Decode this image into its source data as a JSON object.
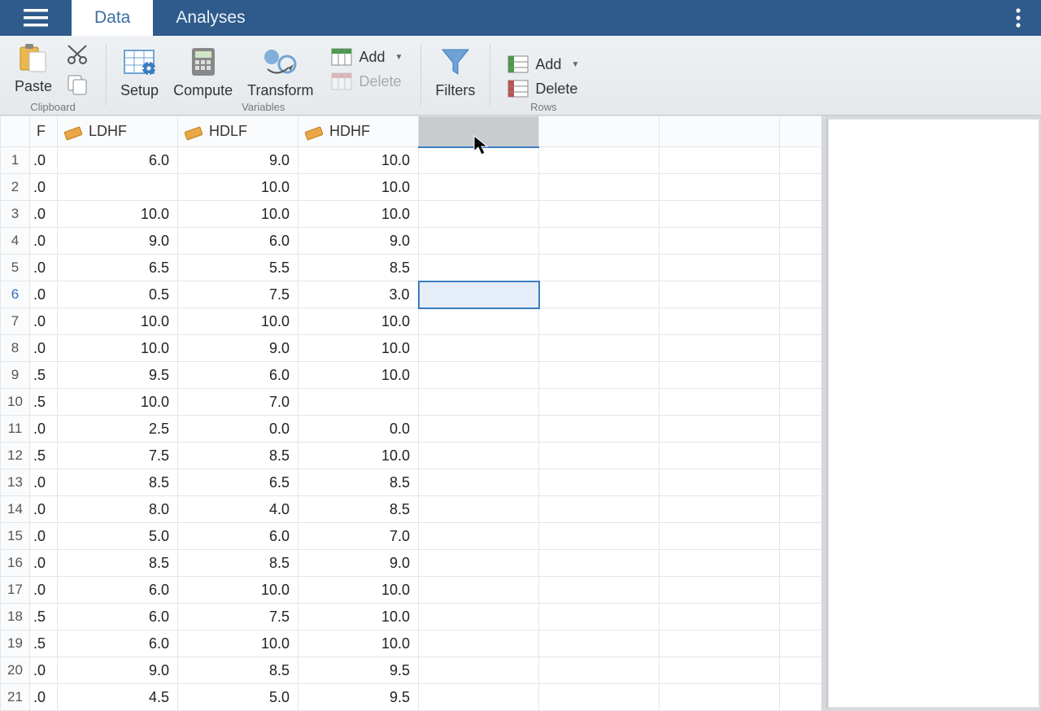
{
  "tabs": {
    "data": "Data",
    "analyses": "Analyses"
  },
  "ribbon": {
    "paste": "Paste",
    "setup": "Setup",
    "compute": "Compute",
    "transform": "Transform",
    "vars_add": "Add",
    "vars_delete": "Delete",
    "filters": "Filters",
    "rows_add": "Add",
    "rows_delete": "Delete",
    "group_clipboard": "Clipboard",
    "group_variables": "Variables",
    "group_rows": "Rows"
  },
  "columns": {
    "c0frag": "F",
    "c1": "LDHF",
    "c2": "HDLF",
    "c3": "HDHF"
  },
  "rows": [
    {
      "frag": ".0",
      "c1": "6.0",
      "c2": "9.0",
      "c3": "10.0"
    },
    {
      "frag": ".0",
      "c1": "",
      "c2": "10.0",
      "c3": "10.0"
    },
    {
      "frag": ".0",
      "c1": "10.0",
      "c2": "10.0",
      "c3": "10.0"
    },
    {
      "frag": ".0",
      "c1": "9.0",
      "c2": "6.0",
      "c3": "9.0"
    },
    {
      "frag": ".0",
      "c1": "6.5",
      "c2": "5.5",
      "c3": "8.5"
    },
    {
      "frag": ".0",
      "c1": "0.5",
      "c2": "7.5",
      "c3": "3.0"
    },
    {
      "frag": ".0",
      "c1": "10.0",
      "c2": "10.0",
      "c3": "10.0"
    },
    {
      "frag": ".0",
      "c1": "10.0",
      "c2": "9.0",
      "c3": "10.0"
    },
    {
      "frag": ".5",
      "c1": "9.5",
      "c2": "6.0",
      "c3": "10.0"
    },
    {
      "frag": ".5",
      "c1": "10.0",
      "c2": "7.0",
      "c3": ""
    },
    {
      "frag": ".0",
      "c1": "2.5",
      "c2": "0.0",
      "c3": "0.0"
    },
    {
      "frag": ".5",
      "c1": "7.5",
      "c2": "8.5",
      "c3": "10.0"
    },
    {
      "frag": ".0",
      "c1": "8.5",
      "c2": "6.5",
      "c3": "8.5"
    },
    {
      "frag": ".0",
      "c1": "8.0",
      "c2": "4.0",
      "c3": "8.5"
    },
    {
      "frag": ".0",
      "c1": "5.0",
      "c2": "6.0",
      "c3": "7.0"
    },
    {
      "frag": ".0",
      "c1": "8.5",
      "c2": "8.5",
      "c3": "9.0"
    },
    {
      "frag": ".0",
      "c1": "6.0",
      "c2": "10.0",
      "c3": "10.0"
    },
    {
      "frag": ".5",
      "c1": "6.0",
      "c2": "7.5",
      "c3": "10.0"
    },
    {
      "frag": ".5",
      "c1": "6.0",
      "c2": "10.0",
      "c3": "10.0"
    },
    {
      "frag": ".0",
      "c1": "9.0",
      "c2": "8.5",
      "c3": "9.5"
    },
    {
      "frag": ".0",
      "c1": "4.5",
      "c2": "5.0",
      "c3": "9.5"
    }
  ],
  "selected_row_index": 5,
  "selected_col_index": 4
}
